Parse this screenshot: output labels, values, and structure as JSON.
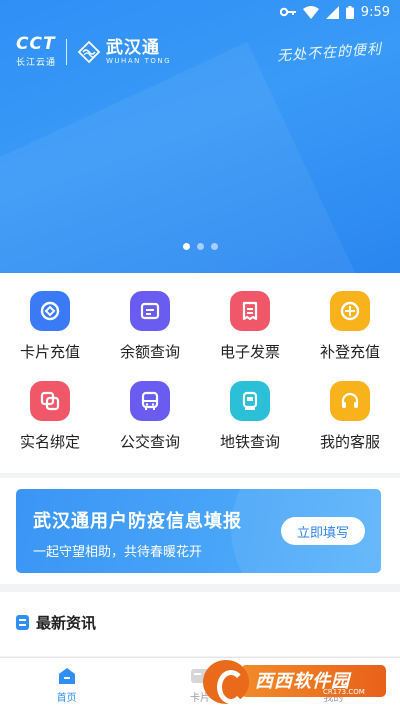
{
  "status_bar": {
    "time": "9:59",
    "icons": [
      "key-icon",
      "wifi-icon",
      "signal-icon",
      "battery-icon"
    ]
  },
  "hero": {
    "brand_cct": "CCT",
    "brand_cct_sub": "长江云通",
    "brand_wuhan": "武汉通",
    "brand_wuhan_en": "WUHAN TONG",
    "slogan": "无处不在的便利",
    "carousel_dots": 3,
    "carousel_active_index": 0,
    "colors": {
      "background": "#2f8ff5"
    }
  },
  "services": [
    {
      "label": "卡片充值",
      "icon": "card-recharge-icon",
      "color": "#3a7bf5"
    },
    {
      "label": "余额查询",
      "icon": "balance-query-icon",
      "color": "#6a5cf0"
    },
    {
      "label": "电子发票",
      "icon": "invoice-icon",
      "color": "#f0586a"
    },
    {
      "label": "补登充值",
      "icon": "supplement-recharge-icon",
      "color": "#f7b21c"
    },
    {
      "label": "实名绑定",
      "icon": "realname-bind-icon",
      "color": "#f0586a"
    },
    {
      "label": "公交查询",
      "icon": "bus-query-icon",
      "color": "#6a5cf0"
    },
    {
      "label": "地铁查询",
      "icon": "metro-query-icon",
      "color": "#2cbfd8"
    },
    {
      "label": "我的客服",
      "icon": "customer-service-icon",
      "color": "#f7b21c"
    }
  ],
  "banner": {
    "title": "武汉通用户防疫信息填报",
    "subtitle": "一起守望相助，共待春暖花开",
    "button": "立即填写"
  },
  "news": {
    "title": "最新资讯"
  },
  "tabbar": {
    "tabs": [
      {
        "label": "首页",
        "icon": "home-icon",
        "active": true
      },
      {
        "label": "卡片",
        "icon": "card-icon",
        "active": false
      },
      {
        "label": "我的",
        "icon": "profile-icon",
        "active": false
      }
    ]
  },
  "watermark": {
    "cn": "西西软件园",
    "en": "CR173.COM"
  }
}
